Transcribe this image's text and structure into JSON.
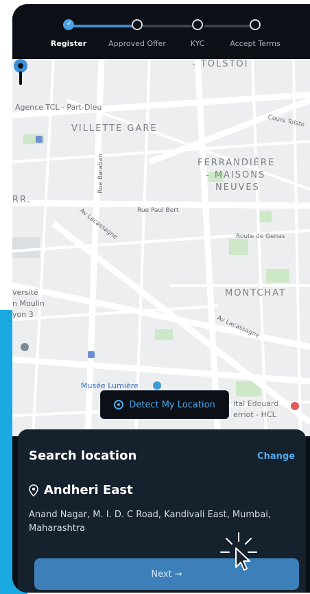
{
  "stepper": {
    "steps": [
      {
        "label": "Register",
        "state": "done"
      },
      {
        "label": "Approved Offer",
        "state": "pending"
      },
      {
        "label": "KYC",
        "state": "pending"
      },
      {
        "label": "Accept Terms",
        "state": "pending"
      }
    ]
  },
  "map": {
    "labels": {
      "tolstoi": "- TOLSTOI",
      "agence": "Agence TCL - Part-Dieu",
      "villette": "VILLETTE GARE",
      "cours": "Cours Tolsto",
      "ferrandiere1": "FERRANDIÈRE",
      "ferrandiere2": "- MAISONS",
      "ferrandiere3": "NEUVES",
      "rr": "RR.",
      "rue_baraban": "Rue Baraban",
      "rue_paul_bert": "Rue Paul Bert",
      "av_lacassagne": "Av Lacassagne",
      "route_genas": "Route de Genas",
      "montchat": "MONTCHAT",
      "versite": "versité",
      "moulin": "n Moulin",
      "yon3": "yon 3",
      "av_lacassagne2": "Av Lacassagne",
      "musee": "Musée Lumière",
      "hospital1": "ital Edouard",
      "hospital2": "erriot - HCL"
    },
    "detect_button": "Detect My Location"
  },
  "sheet": {
    "title": "Search location",
    "change": "Change",
    "location_name": "Andheri East",
    "address": "Anand Nagar, M. I. D. C Road, Kandivali East, Mumbai, Maharashtra",
    "next": "Next →"
  },
  "colors": {
    "accent": "#4fa9ec",
    "sheet_bg": "#15212c",
    "next_button": "#3d7fb8",
    "side_block": "#1aa9e0"
  }
}
